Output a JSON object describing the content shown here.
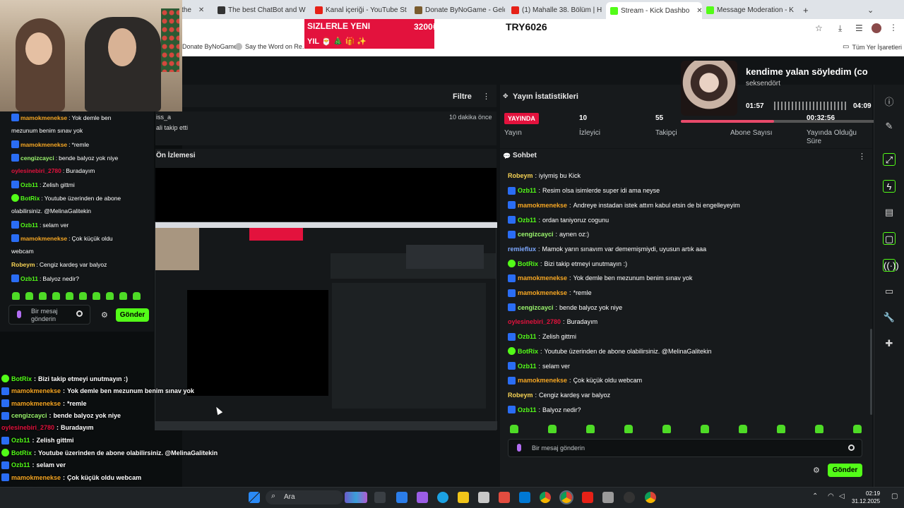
{
  "browser": {
    "tabs": [
      {
        "label": "the",
        "active": false
      },
      {
        "label": "The best ChatBot and W",
        "active": false
      },
      {
        "label": "Kanal içeriği - YouTube St",
        "active": false
      },
      {
        "label": "Donate ByNoGame - Gelc",
        "active": false
      },
      {
        "label": "(1) Mahalle 38. Bölüm | H",
        "active": false
      },
      {
        "label": "Stream - Kick Dashbo",
        "active": true
      },
      {
        "label": "Message Moderation - K",
        "active": false
      }
    ],
    "new_tab": "+",
    "bookmarks": [
      "Donate ByNoGame",
      "Say the Word on Re...",
      "Tüm Yer İşaretleri"
    ]
  },
  "donation": {
    "line1": "SIZLERLE YENI",
    "line2": "YIL 🎅 🎄 🎁 ✨",
    "amount": "3200₺",
    "code": "TRY6026"
  },
  "dashboard": {
    "filter_label": "Filtre",
    "stats_title": "Yayın İstatistikleri",
    "live_badge": "YAYINDA",
    "stats": [
      {
        "value": "",
        "label": "Yayın"
      },
      {
        "value": "10",
        "label": "İzleyici"
      },
      {
        "value": "55",
        "label": "Takipçi"
      },
      {
        "value": "",
        "label": "Abone Sayısı"
      },
      {
        "value": "00:32:56",
        "label": "Yayında Olduğu Süre"
      }
    ],
    "notice_a": "iss_a",
    "notice_b": "ali takip etti",
    "notice_time": "10 dakika önce",
    "preview_title": "Ön İzlemesi",
    "chat_title": "Sohbet",
    "chat_placeholder": "Bir mesaj gönderin",
    "send_label": "Gönder"
  },
  "now_playing": {
    "title": "kendime yalan söyledim (co",
    "artist": "seksendört",
    "elapsed": "01:57",
    "total": "04:09",
    "progress": 0.47
  },
  "chat": [
    {
      "user": "Robeym",
      "text": "iyiymiş bu Kick",
      "color": "yellow",
      "badge": "none"
    },
    {
      "user": "Ozb11",
      "text": "Resim olsa isimlerde super idi ama neyse",
      "color": "green",
      "badge": "user"
    },
    {
      "user": "mamokmenekse",
      "text": "Andreye instadan istek attım kabul etsin de bi engelleyeyim",
      "color": "orange",
      "badge": "user"
    },
    {
      "user": "Ozb11",
      "text": "ordan taniyoruz cogunu",
      "color": "green",
      "badge": "user"
    },
    {
      "user": "cengizcayci",
      "text": "aynen oz:)",
      "color": "lime",
      "badge": "user"
    },
    {
      "user": "remieflux",
      "text": "Mamok yarın sınavım var dememişmiydi, uyusun artık aaa",
      "color": "blue",
      "badge": "none"
    },
    {
      "user": "BotRix",
      "text": "Bizi takip etmeyi unutmayın :)",
      "color": "green",
      "badge": "bot"
    },
    {
      "user": "mamokmenekse",
      "text": "Yok demle ben mezunum benim sınav yok",
      "color": "orange",
      "badge": "user"
    },
    {
      "user": "mamokmenekse",
      "text": "*remle",
      "color": "orange",
      "badge": "user"
    },
    {
      "user": "cengizcayci",
      "text": "bende balyoz yok niye",
      "color": "lime",
      "badge": "user"
    },
    {
      "user": "oylesinebiri_2780",
      "text": "Buradayım",
      "color": "red",
      "badge": "none"
    },
    {
      "user": "Ozb11",
      "text": "Zelish gittmi",
      "color": "green",
      "badge": "user"
    },
    {
      "user": "BotRix",
      "text": "Youtube üzerinden de abone olabilirsiniz. @MelinaGalitekin",
      "color": "green",
      "badge": "bot"
    },
    {
      "user": "Ozb11",
      "text": "selam ver",
      "color": "green",
      "badge": "user"
    },
    {
      "user": "mamokmenekse",
      "text": "Çok küçük oldu webcam",
      "color": "orange",
      "badge": "user"
    },
    {
      "user": "Robeym",
      "text": "Cengiz kardeş var balyoz",
      "color": "yellow",
      "badge": "none"
    },
    {
      "user": "Ozb11",
      "text": "Balyoz nedir?",
      "color": "green",
      "badge": "user"
    }
  ],
  "left_chat": [
    {
      "user": "mamokmenekse",
      "text": "Yok demle ben",
      "color": "orange",
      "badge": "user"
    },
    {
      "user": "",
      "text": "mezunum benim sınav yok",
      "color": "orange",
      "badge": "none"
    },
    {
      "user": "mamokmenekse",
      "text": "*remle",
      "color": "orange",
      "badge": "user"
    },
    {
      "user": "cengizcayci",
      "text": "bende balyoz yok niye",
      "color": "lime",
      "badge": "user"
    },
    {
      "user": "oylesinebiri_2780",
      "text": "Buradayım",
      "color": "red",
      "badge": "none"
    },
    {
      "user": "Ozb11",
      "text": "Zelish gittmi",
      "color": "green",
      "badge": "user"
    },
    {
      "user": "BotRix",
      "text": "Youtube üzerinden de abone",
      "color": "green",
      "badge": "bot"
    },
    {
      "user": "",
      "text": "olabilirsiniz. @MelinaGalitekin",
      "color": "green",
      "badge": "none"
    },
    {
      "user": "Ozb11",
      "text": "selam ver",
      "color": "green",
      "badge": "user"
    },
    {
      "user": "mamokmenekse",
      "text": "Çok küçük oldu",
      "color": "orange",
      "badge": "user"
    },
    {
      "user": "",
      "text": "webcam",
      "color": "orange",
      "badge": "none"
    },
    {
      "user": "Robeym",
      "text": "Cengiz kardeş var balyoz",
      "color": "yellow",
      "badge": "none"
    },
    {
      "user": "Ozb11",
      "text": "Balyoz nedir?",
      "color": "green",
      "badge": "user"
    }
  ],
  "left_input_placeholder": "Bir mesaj gönderin",
  "left_send_label": "Gönder",
  "bottom_chat": [
    {
      "user": "BotRix",
      "text": "Bizi takip etmeyi unutmayın :)",
      "color": "green",
      "badge": "bot"
    },
    {
      "user": "mamokmenekse",
      "text": "Yok demle ben mezunum benim sınav yok",
      "color": "orange",
      "badge": "user"
    },
    {
      "user": "mamokmenekse",
      "text": "*remle",
      "color": "orange",
      "badge": "user"
    },
    {
      "user": "cengizcayci",
      "text": "bende balyoz yok niye",
      "color": "lime",
      "badge": "user"
    },
    {
      "user": "oylesinebiri_2780",
      "text": "Buradayım",
      "color": "red",
      "badge": "none"
    },
    {
      "user": "Ozb11",
      "text": "Zelish gittmi",
      "color": "green",
      "badge": "user"
    },
    {
      "user": "BotRix",
      "text": "Youtube üzerinden de abone olabilirsiniz. @MelinaGalitekin",
      "color": "green",
      "badge": "bot"
    },
    {
      "user": "Ozb11",
      "text": "selam ver",
      "color": "green",
      "badge": "user"
    },
    {
      "user": "mamokmenekse",
      "text": "Çok küçük oldu webcam",
      "color": "orange",
      "badge": "user"
    },
    {
      "user": "Robeym",
      "text": "Cengiz kardeş var balyoz",
      "color": "yellow",
      "badge": "none"
    },
    {
      "user": "Ozb11",
      "text": "Balyoz nedir?",
      "color": "green",
      "badge": "user"
    }
  ],
  "taskbar": {
    "search": "Ara",
    "time": "02:19",
    "date": "31.12.2025"
  },
  "colors": {
    "kick_green": "#53fc18",
    "live_red": "#e3123d",
    "panel_bg": "#171a1c"
  }
}
